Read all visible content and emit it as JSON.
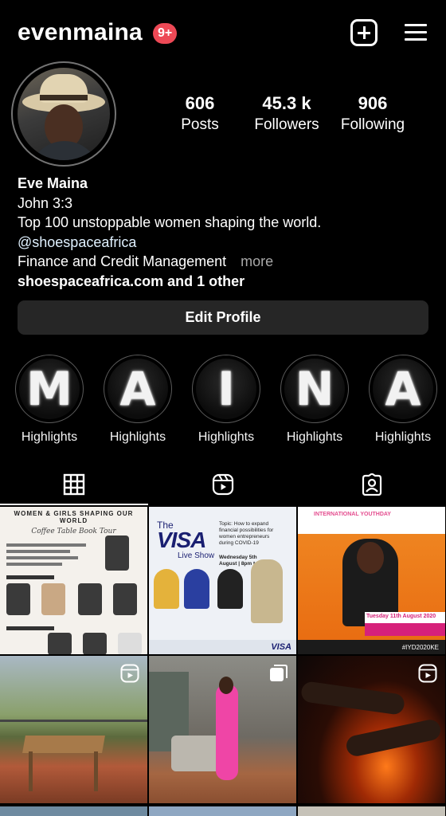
{
  "header": {
    "username": "evenmaina",
    "notification_count": "9+"
  },
  "profile": {
    "stats": [
      {
        "value": "606",
        "label": "Posts"
      },
      {
        "value": "45.3 k",
        "label": "Followers"
      },
      {
        "value": "906",
        "label": "Following"
      }
    ],
    "name": "Eve Maina",
    "bio_lines": [
      "John 3:3",
      "Top 100 unstoppable women shaping the world."
    ],
    "mention": "@shoespaceafrica",
    "category": "Finance and Credit Management",
    "more_label": "more",
    "website": "shoespaceafrica.com and 1 other",
    "edit_button": "Edit Profile"
  },
  "highlights": [
    {
      "letter": "M",
      "label": "Highlights"
    },
    {
      "letter": "A",
      "label": "Highlights"
    },
    {
      "letter": "I",
      "label": "Highlights"
    },
    {
      "letter": "N",
      "label": "Highlights"
    },
    {
      "letter": "A",
      "label": "Highlights"
    }
  ],
  "tabs": [
    {
      "name": "grid-tab",
      "icon": "grid-icon",
      "active": true
    },
    {
      "name": "reels-tab",
      "icon": "reels-icon",
      "active": false
    },
    {
      "name": "tagged-tab",
      "icon": "tagged-icon",
      "active": false
    }
  ],
  "posts": {
    "post1": {
      "title": "WOMEN & GIRLS SHAPING OUR WORLD",
      "subtitle": "Coffee Table Book Tour",
      "label_a": "MEET THE PANELISTS:",
      "label_b": "MEET THE PANELISTS:"
    },
    "post2": {
      "the": "The",
      "brand": "VISA",
      "show": "Live Show",
      "topic": "Topic: How to expand financial possibilities for women entrepreneurs during COVID-19",
      "date": "Wednesday 5th August | 8pm to 9pm",
      "footer_brand": "VISA"
    },
    "post3": {
      "header": "INTERNATIONAL YOUTHDAY",
      "date": "Tuesday 11th August 2020",
      "tag": "#IYD2020KE"
    }
  },
  "colors": {
    "background": "#000000",
    "badge": "#ed4956",
    "button_bg": "#262626",
    "muted_text": "#a8a8a8"
  }
}
